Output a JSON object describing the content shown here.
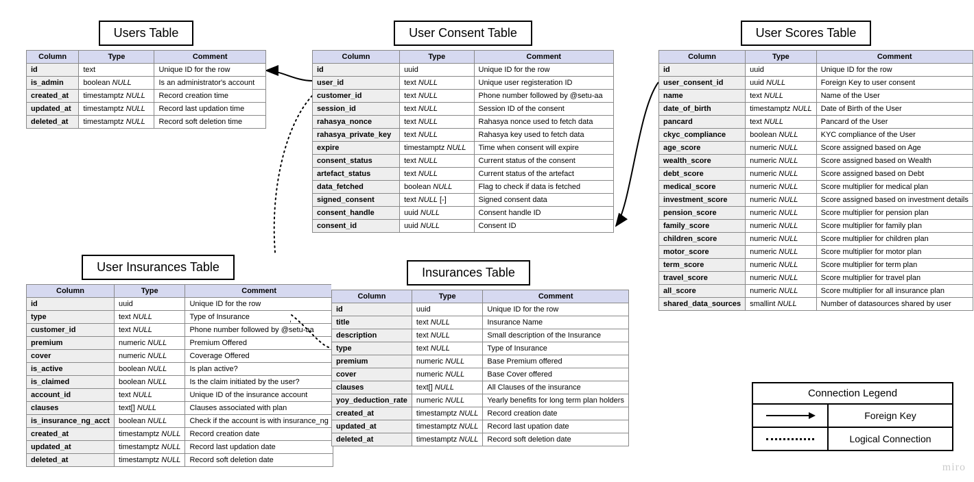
{
  "headers": {
    "col": "Column",
    "type": "Type",
    "comment": "Comment"
  },
  "nullTag": "NULL",
  "tables": {
    "users": {
      "title": "Users Table",
      "rows": [
        {
          "name": "id",
          "type": "text",
          "null": false,
          "comment": "Unique ID for the row"
        },
        {
          "name": "is_admin",
          "type": "boolean",
          "null": true,
          "comment": "Is an administrator's account"
        },
        {
          "name": "created_at",
          "type": "timestamptz",
          "null": true,
          "comment": "Record creation time"
        },
        {
          "name": "updated_at",
          "type": "timestamptz",
          "null": true,
          "comment": "Record last updation time"
        },
        {
          "name": "deleted_at",
          "type": "timestamptz",
          "null": true,
          "comment": "Record soft deletion time"
        }
      ]
    },
    "consent": {
      "title": "User Consent Table",
      "rows": [
        {
          "name": "id",
          "type": "uuid",
          "null": false,
          "comment": "Unique ID for the row"
        },
        {
          "name": "user_id",
          "type": "text",
          "null": true,
          "comment": "Unique user registeration ID"
        },
        {
          "name": "customer_id",
          "type": "text",
          "null": true,
          "comment": "Phone number followed by @setu-aa"
        },
        {
          "name": "session_id",
          "type": "text",
          "null": true,
          "comment": "Session ID of the consent"
        },
        {
          "name": "rahasya_nonce",
          "type": "text",
          "null": true,
          "comment": "Rahasya nonce used to fetch data"
        },
        {
          "name": "rahasya_private_key",
          "type": "text",
          "null": true,
          "comment": "Rahasya key used to fetch data"
        },
        {
          "name": "expire",
          "type": "timestamptz",
          "null": true,
          "comment": "Time when consent will expire"
        },
        {
          "name": "consent_status",
          "type": "text",
          "null": true,
          "comment": "Current status of the consent"
        },
        {
          "name": "artefact_status",
          "type": "text",
          "null": true,
          "comment": "Current status of the artefact"
        },
        {
          "name": "data_fetched",
          "type": "boolean",
          "null": true,
          "comment": "Flag to check if data is fetched"
        },
        {
          "name": "signed_consent",
          "type": "text",
          "null": true,
          "extra": " [-]",
          "comment": "Signed consent data"
        },
        {
          "name": "consent_handle",
          "type": "uuid",
          "null": true,
          "comment": "Consent handle ID"
        },
        {
          "name": "consent_id",
          "type": "uuid",
          "null": true,
          "comment": "Consent ID"
        }
      ]
    },
    "scores": {
      "title": "User Scores Table",
      "rows": [
        {
          "name": "id",
          "type": "uuid",
          "null": false,
          "comment": "Unique ID for the row"
        },
        {
          "name": "user_consent_id",
          "type": "uuid",
          "null": true,
          "comment": "Foreign Key to user consent"
        },
        {
          "name": "name",
          "type": "text",
          "null": true,
          "comment": "Name of the User"
        },
        {
          "name": "date_of_birth",
          "type": "timestamptz",
          "null": true,
          "comment": "Date of Birth of the User"
        },
        {
          "name": "pancard",
          "type": "text",
          "null": true,
          "comment": "Pancard of the User"
        },
        {
          "name": "ckyc_compliance",
          "type": "boolean",
          "null": true,
          "comment": "KYC compliance of the User"
        },
        {
          "name": "age_score",
          "type": "numeric",
          "null": true,
          "comment": "Score assigned based on Age"
        },
        {
          "name": "wealth_score",
          "type": "numeric",
          "null": true,
          "comment": "Score assigned based on Wealth"
        },
        {
          "name": "debt_score",
          "type": "numeric",
          "null": true,
          "comment": "Score assigned based on Debt"
        },
        {
          "name": "medical_score",
          "type": "numeric",
          "null": true,
          "comment": "Score multiplier for medical plan"
        },
        {
          "name": "investment_score",
          "type": "numeric",
          "null": true,
          "comment": "Score assigned based on investment details"
        },
        {
          "name": "pension_score",
          "type": "numeric",
          "null": true,
          "comment": "Score multiplier for pension plan"
        },
        {
          "name": "family_score",
          "type": "numeric",
          "null": true,
          "comment": "Score multiplier for family plan"
        },
        {
          "name": "children_score",
          "type": "numeric",
          "null": true,
          "comment": "Score multiplier for children plan"
        },
        {
          "name": "motor_score",
          "type": "numeric",
          "null": true,
          "comment": "Score multiplier for motor plan"
        },
        {
          "name": "term_score",
          "type": "numeric",
          "null": true,
          "comment": "Score multiplier for term plan"
        },
        {
          "name": "travel_score",
          "type": "numeric",
          "null": true,
          "comment": "Score multiplier for travel plan"
        },
        {
          "name": "all_score",
          "type": "numeric",
          "null": true,
          "comment": "Score multiplier for all insurance plan"
        },
        {
          "name": "shared_data_sources",
          "type": "smallint",
          "null": true,
          "comment": "Number of datasources shared by user"
        }
      ]
    },
    "userins": {
      "title": "User Insurances Table",
      "rows": [
        {
          "name": "id",
          "type": "uuid",
          "null": false,
          "comment": "Unique ID for the row"
        },
        {
          "name": "type",
          "type": "text",
          "null": true,
          "comment": "Type of Insurance"
        },
        {
          "name": "customer_id",
          "type": "text",
          "null": true,
          "comment": "Phone number followed by @setu-aa"
        },
        {
          "name": "premium",
          "type": "numeric",
          "null": true,
          "comment": "Premium Offered"
        },
        {
          "name": "cover",
          "type": "numeric",
          "null": true,
          "comment": "Coverage Offered"
        },
        {
          "name": "is_active",
          "type": "boolean",
          "null": true,
          "comment": "Is plan active?"
        },
        {
          "name": "is_claimed",
          "type": "boolean",
          "null": true,
          "comment": "Is the claim initiated by the user?"
        },
        {
          "name": "account_id",
          "type": "text",
          "null": true,
          "comment": "Unique ID of the insurance account"
        },
        {
          "name": "clauses",
          "type": "text[]",
          "null": true,
          "comment": "Clauses associated with plan"
        },
        {
          "name": "is_insurance_ng_acct",
          "type": "boolean",
          "null": true,
          "comment": "Check if the account is with insurance_ng"
        },
        {
          "name": "created_at",
          "type": "timestamptz",
          "null": true,
          "comment": "Record creation date"
        },
        {
          "name": "updated_at",
          "type": "timestamptz",
          "null": true,
          "comment": "Record last updation date"
        },
        {
          "name": "deleted_at",
          "type": "timestamptz",
          "null": true,
          "comment": "Record soft deletion date"
        }
      ]
    },
    "ins": {
      "title": "Insurances Table",
      "rows": [
        {
          "name": "id",
          "type": "uuid",
          "null": false,
          "comment": "Unique ID for the row"
        },
        {
          "name": "title",
          "type": "text",
          "null": true,
          "comment": "Insurance Name"
        },
        {
          "name": "description",
          "type": "text",
          "null": true,
          "comment": "Small description of the Insurance"
        },
        {
          "name": "type",
          "type": "text",
          "null": true,
          "comment": "Type of Insurance"
        },
        {
          "name": "premium",
          "type": "numeric",
          "null": true,
          "comment": "Base Premium offered"
        },
        {
          "name": "cover",
          "type": "numeric",
          "null": true,
          "comment": "Base Cover offered"
        },
        {
          "name": "clauses",
          "type": "text[]",
          "null": true,
          "comment": "All Clauses of the insurance"
        },
        {
          "name": "yoy_deduction_rate",
          "type": "numeric",
          "null": true,
          "comment": "Yearly benefits for long term plan holders"
        },
        {
          "name": "created_at",
          "type": "timestamptz",
          "null": true,
          "comment": "Record creation date"
        },
        {
          "name": "updated_at",
          "type": "timestamptz",
          "null": true,
          "comment": "Record last upation date"
        },
        {
          "name": "deleted_at",
          "type": "timestamptz",
          "null": true,
          "comment": "Record soft deletion date"
        }
      ]
    }
  },
  "legend": {
    "title": "Connection Legend",
    "fk": "Foreign Key",
    "logical": "Logical Connection"
  },
  "watermark": "miro"
}
